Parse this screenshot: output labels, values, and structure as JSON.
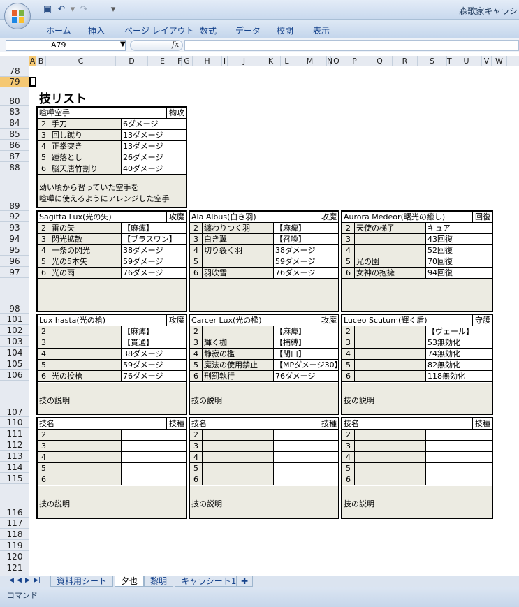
{
  "window": {
    "title": "森歌家キャラシ"
  },
  "quick_access": {
    "save_icon": "save-icon",
    "undo_icon": "undo-icon",
    "redo_icon": "redo-icon"
  },
  "ribbon": {
    "tabs": [
      "ホーム",
      "挿入",
      "ページ レイアウト",
      "数式",
      "データ",
      "校閲",
      "表示"
    ]
  },
  "formula_bar": {
    "name_box": "A79",
    "fx": "fx",
    "formula": ""
  },
  "columns": [
    "A",
    "B",
    "C",
    "D",
    "E",
    "F",
    "G",
    "H",
    "I",
    "J",
    "K",
    "L",
    "M",
    "N",
    "O",
    "P",
    "Q",
    "R",
    "S",
    "T",
    "U",
    "V",
    "W"
  ],
  "rows": [
    "78",
    "79",
    "80",
    "83",
    "84",
    "85",
    "86",
    "87",
    "88",
    "89",
    "92",
    "93",
    "94",
    "95",
    "96",
    "97",
    "98",
    "101",
    "102",
    "103",
    "104",
    "105",
    "106",
    "107",
    "110",
    "111",
    "112",
    "113",
    "114",
    "115",
    "116",
    "117",
    "118",
    "119",
    "120",
    "121"
  ],
  "sheet": {
    "title": "技リスト",
    "block1": {
      "name": "喧嘩空手",
      "type": "物攻",
      "rows": [
        {
          "n": "2",
          "name": "手刀",
          "effect": "6ダメージ"
        },
        {
          "n": "3",
          "name": "回し蹴り",
          "effect": "13ダメージ"
        },
        {
          "n": "4",
          "name": "正拳突き",
          "effect": "13ダメージ"
        },
        {
          "n": "5",
          "name": "踵落とし",
          "effect": "26ダメージ"
        },
        {
          "n": "6",
          "name": "脳天唐竹割り",
          "effect": "40ダメージ"
        }
      ],
      "desc_line1": "幼い頃から習っていた空手を",
      "desc_line2": "喧嘩に使えるようにアレンジした空手"
    },
    "block2": {
      "name": "Sagitta Lux(光の矢)",
      "type": "攻魔",
      "rows": [
        {
          "n": "2",
          "name": "雷の矢",
          "effect": "【麻痺】"
        },
        {
          "n": "3",
          "name": "閃光拡散",
          "effect": "【ブラスワン】"
        },
        {
          "n": "4",
          "name": "一条の閃光",
          "effect": "38ダメージ"
        },
        {
          "n": "5",
          "name": "光の5本矢",
          "effect": "59ダメージ"
        },
        {
          "n": "6",
          "name": "光の雨",
          "effect": "76ダメージ"
        }
      ],
      "desc": ""
    },
    "block3": {
      "name": "Ala Albus(白き羽)",
      "type": "攻魔",
      "rows": [
        {
          "n": "2",
          "name": "纏わりつく羽",
          "effect": "【麻痺】"
        },
        {
          "n": "3",
          "name": "白き翼",
          "effect": "【召喚】"
        },
        {
          "n": "4",
          "name": "切り裂く羽",
          "effect": "38ダメージ"
        },
        {
          "n": "5",
          "name": "",
          "effect": "59ダメージ"
        },
        {
          "n": "6",
          "name": "羽吹雪",
          "effect": "76ダメージ"
        }
      ],
      "desc": ""
    },
    "block4": {
      "name": "Aurora Medeor(曙光の癒し)",
      "type": "回復",
      "rows": [
        {
          "n": "2",
          "name": "天使の梯子",
          "effect": "キュア"
        },
        {
          "n": "3",
          "name": "",
          "effect": "43回復"
        },
        {
          "n": "4",
          "name": "",
          "effect": "52回復"
        },
        {
          "n": "5",
          "name": "光の園",
          "effect": "70回復"
        },
        {
          "n": "6",
          "name": "女神の抱擁",
          "effect": "94回復"
        }
      ],
      "desc": ""
    },
    "block5": {
      "name": "Lux hasta(光の槍)",
      "type": "攻魔",
      "rows": [
        {
          "n": "2",
          "name": "",
          "effect": "【麻痺】"
        },
        {
          "n": "3",
          "name": "",
          "effect": "【貫通】"
        },
        {
          "n": "4",
          "name": "",
          "effect": "38ダメージ"
        },
        {
          "n": "5",
          "name": "",
          "effect": "59ダメージ"
        },
        {
          "n": "6",
          "name": "光の投槍",
          "effect": "76ダメージ"
        }
      ],
      "desc": "技の説明"
    },
    "block6": {
      "name": "Carcer Lux(光の檻)",
      "type": "攻魔",
      "rows": [
        {
          "n": "2",
          "name": "",
          "effect": "【麻痺】"
        },
        {
          "n": "3",
          "name": "輝く枷",
          "effect": "【捕縛】"
        },
        {
          "n": "4",
          "name": "静寂の檻",
          "effect": "【閉口】"
        },
        {
          "n": "5",
          "name": "魔法の使用禁止",
          "effect": "【MPダメージ30】"
        },
        {
          "n": "6",
          "name": "刑罰執行",
          "effect": "76ダメージ"
        }
      ],
      "desc": "技の説明"
    },
    "block7": {
      "name": "Luceo Scutum(輝く盾)",
      "type": "守護",
      "rows": [
        {
          "n": "2",
          "name": "",
          "effect": "【ヴェール】"
        },
        {
          "n": "3",
          "name": "",
          "effect": "53無効化"
        },
        {
          "n": "4",
          "name": "",
          "effect": "74無効化"
        },
        {
          "n": "5",
          "name": "",
          "effect": "82無効化"
        },
        {
          "n": "6",
          "name": "",
          "effect": "118無効化"
        }
      ],
      "desc": "技の説明"
    },
    "block8": {
      "name": "技名",
      "type": "技種",
      "rows": [
        {
          "n": "2",
          "name": "",
          "effect": ""
        },
        {
          "n": "3",
          "name": "",
          "effect": ""
        },
        {
          "n": "4",
          "name": "",
          "effect": ""
        },
        {
          "n": "5",
          "name": "",
          "effect": ""
        },
        {
          "n": "6",
          "name": "",
          "effect": ""
        }
      ],
      "desc": "技の説明"
    },
    "block9": {
      "name": "技名",
      "type": "技種",
      "rows": [
        {
          "n": "2",
          "name": "",
          "effect": ""
        },
        {
          "n": "3",
          "name": "",
          "effect": ""
        },
        {
          "n": "4",
          "name": "",
          "effect": ""
        },
        {
          "n": "5",
          "name": "",
          "effect": ""
        },
        {
          "n": "6",
          "name": "",
          "effect": ""
        }
      ],
      "desc": "技の説明"
    },
    "block10": {
      "name": "技名",
      "type": "技種",
      "rows": [
        {
          "n": "2",
          "name": "",
          "effect": ""
        },
        {
          "n": "3",
          "name": "",
          "effect": ""
        },
        {
          "n": "4",
          "name": "",
          "effect": ""
        },
        {
          "n": "5",
          "name": "",
          "effect": ""
        },
        {
          "n": "6",
          "name": "",
          "effect": ""
        }
      ],
      "desc": "技の説明"
    }
  },
  "sheet_tabs": [
    "資料用シート",
    "夕也",
    "黎明",
    "キャラシート1"
  ],
  "status": {
    "mode": "コマンド"
  }
}
